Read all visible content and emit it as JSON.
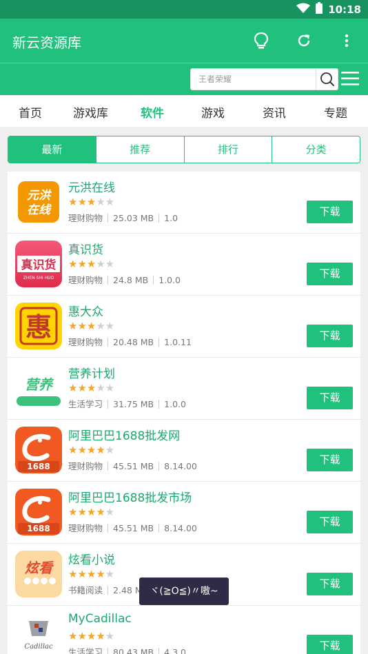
{
  "status_bar": {
    "time": "10:18",
    "wifi_icon": "wifi-icon",
    "battery_icon": "battery-icon"
  },
  "app_bar": {
    "title": "新云资源库",
    "icons": [
      "lightbulb-icon",
      "refresh-icon",
      "more-vert-icon"
    ]
  },
  "search": {
    "placeholder": "王者荣耀",
    "value": ""
  },
  "tabs": [
    {
      "label": "首页",
      "active": false
    },
    {
      "label": "游戏库",
      "active": false
    },
    {
      "label": "软件",
      "active": true
    },
    {
      "label": "游戏",
      "active": false
    },
    {
      "label": "资讯",
      "active": false
    },
    {
      "label": "专题",
      "active": false
    }
  ],
  "segments": [
    {
      "label": "最新",
      "active": true
    },
    {
      "label": "推荐",
      "active": false
    },
    {
      "label": "排行",
      "active": false
    },
    {
      "label": "分类",
      "active": false
    }
  ],
  "download_label": "下载",
  "apps": [
    {
      "name": "元洪在线",
      "rating": 3,
      "category": "理财购物",
      "size": "25.03 MB",
      "version": "1.0",
      "icon_text": "元洪在线",
      "icon_color": "#f39800"
    },
    {
      "name": "真识货",
      "rating": 3,
      "category": "理财购物",
      "size": "24.8 MB",
      "version": "1.0.0",
      "icon_text": "真识货",
      "icon_color": "#e8385a"
    },
    {
      "name": "惠大众",
      "rating": 3,
      "category": "理财购物",
      "size": "20.48 MB",
      "version": "1.0.11",
      "icon_text": "惠",
      "icon_color": "#ffd400"
    },
    {
      "name": "营养计划",
      "rating": 3,
      "category": "生活学习",
      "size": "31.75 MB",
      "version": "1.0.0",
      "icon_text": "营养",
      "icon_color": "#3cc27a"
    },
    {
      "name": "阿里巴巴1688批发网",
      "rating": 4,
      "category": "理财购物",
      "size": "45.51 MB",
      "version": "8.14.00",
      "icon_text": "1688",
      "icon_color": "#f05a22"
    },
    {
      "name": "阿里巴巴1688批发市场",
      "rating": 4,
      "category": "理财购物",
      "size": "45.51 MB",
      "version": "8.14.00",
      "icon_text": "1688",
      "icon_color": "#f05a22"
    },
    {
      "name": "炫看小说",
      "rating": 4,
      "category": "书籍阅读",
      "size": "2.48 MB",
      "version": "",
      "icon_text": "炫看",
      "icon_color": "#fcd9a0"
    },
    {
      "name": "MyCadillac",
      "rating": 4,
      "category": "生活学习",
      "size": "80.43 MB",
      "version": "4.3.0",
      "icon_text": "Cadillac",
      "icon_color": "#ffffff"
    }
  ],
  "toast": {
    "text": "ヾ(≧O≦)〃嗷~"
  }
}
